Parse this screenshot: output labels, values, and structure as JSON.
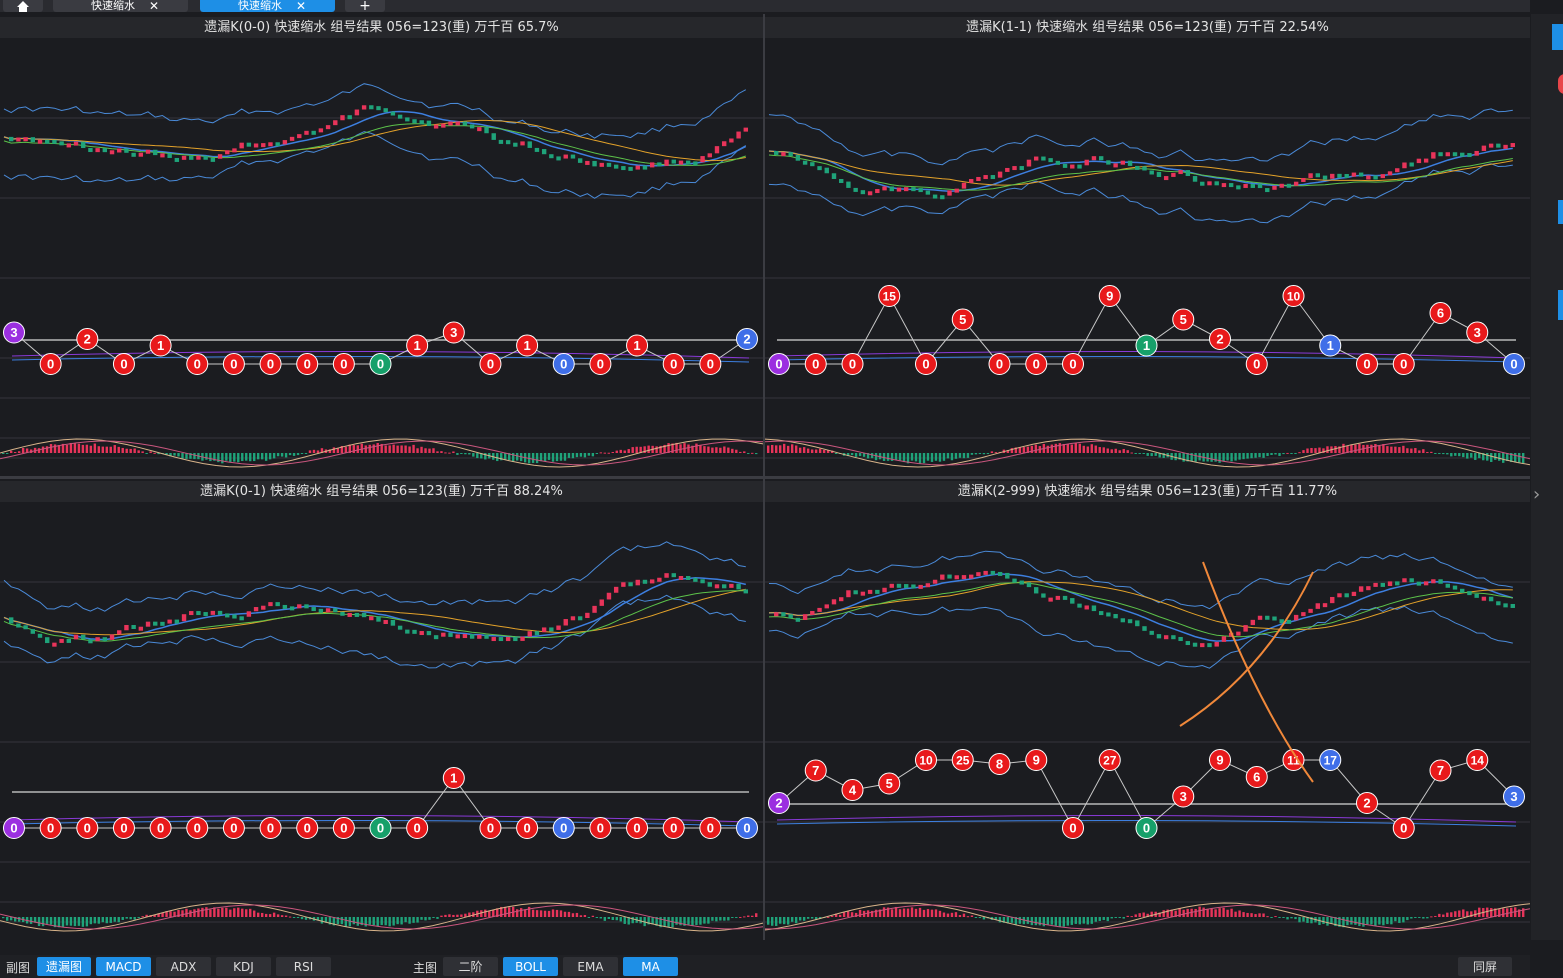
{
  "tabs": [
    {
      "icon": "home-icon"
    },
    {
      "label": "快速缩水",
      "close": "✕"
    },
    {
      "label": "快速缩水",
      "close": "✕",
      "active": true
    },
    {
      "icon": "plus-icon",
      "label": "+"
    }
  ],
  "panels": [
    {
      "title": "遗漏K(0-0)  快速缩水  组号结果 056=123(重)  万千百  65.7%",
      "balls": [
        {
          "v": "3",
          "c": "purple"
        },
        {
          "v": "0",
          "c": "red"
        },
        {
          "v": "2",
          "c": "red"
        },
        {
          "v": "0",
          "c": "red"
        },
        {
          "v": "1",
          "c": "red"
        },
        {
          "v": "0",
          "c": "red"
        },
        {
          "v": "0",
          "c": "red"
        },
        {
          "v": "0",
          "c": "red"
        },
        {
          "v": "0",
          "c": "red"
        },
        {
          "v": "0",
          "c": "red"
        },
        {
          "v": "0",
          "c": "green"
        },
        {
          "v": "1",
          "c": "red"
        },
        {
          "v": "3",
          "c": "red"
        },
        {
          "v": "0",
          "c": "red"
        },
        {
          "v": "1",
          "c": "red"
        },
        {
          "v": "0",
          "c": "blue"
        },
        {
          "v": "0",
          "c": "red"
        },
        {
          "v": "1",
          "c": "red"
        },
        {
          "v": "0",
          "c": "red"
        },
        {
          "v": "0",
          "c": "red"
        },
        {
          "v": "2",
          "c": "blue"
        }
      ]
    },
    {
      "title": "遗漏K(1-1)  快速缩水  组号结果 056=123(重)  万千百  22.54%",
      "balls": [
        {
          "v": "0",
          "c": "purple"
        },
        {
          "v": "0",
          "c": "red"
        },
        {
          "v": "0",
          "c": "red"
        },
        {
          "v": "15",
          "c": "red"
        },
        {
          "v": "0",
          "c": "red"
        },
        {
          "v": "5",
          "c": "red"
        },
        {
          "v": "0",
          "c": "red"
        },
        {
          "v": "0",
          "c": "red"
        },
        {
          "v": "0",
          "c": "red"
        },
        {
          "v": "9",
          "c": "red"
        },
        {
          "v": "1",
          "c": "green"
        },
        {
          "v": "5",
          "c": "red"
        },
        {
          "v": "2",
          "c": "red"
        },
        {
          "v": "0",
          "c": "red"
        },
        {
          "v": "10",
          "c": "red"
        },
        {
          "v": "1",
          "c": "blue"
        },
        {
          "v": "0",
          "c": "red"
        },
        {
          "v": "0",
          "c": "red"
        },
        {
          "v": "6",
          "c": "red"
        },
        {
          "v": "3",
          "c": "red"
        },
        {
          "v": "0",
          "c": "blue"
        }
      ]
    },
    {
      "title": "遗漏K(0-1)  快速缩水  组号结果 056=123(重)  万千百  88.24%",
      "balls": [
        {
          "v": "0",
          "c": "purple"
        },
        {
          "v": "0",
          "c": "red"
        },
        {
          "v": "0",
          "c": "red"
        },
        {
          "v": "0",
          "c": "red"
        },
        {
          "v": "0",
          "c": "red"
        },
        {
          "v": "0",
          "c": "red"
        },
        {
          "v": "0",
          "c": "red"
        },
        {
          "v": "0",
          "c": "red"
        },
        {
          "v": "0",
          "c": "red"
        },
        {
          "v": "0",
          "c": "red"
        },
        {
          "v": "0",
          "c": "green"
        },
        {
          "v": "0",
          "c": "red"
        },
        {
          "v": "1",
          "c": "red"
        },
        {
          "v": "0",
          "c": "red"
        },
        {
          "v": "0",
          "c": "red"
        },
        {
          "v": "0",
          "c": "blue"
        },
        {
          "v": "0",
          "c": "red"
        },
        {
          "v": "0",
          "c": "red"
        },
        {
          "v": "0",
          "c": "red"
        },
        {
          "v": "0",
          "c": "red"
        },
        {
          "v": "0",
          "c": "blue"
        }
      ]
    },
    {
      "title": "遗漏K(2-999)  快速缩水  组号结果 056=123(重)  万千百  11.77%",
      "balls": [
        {
          "v": "2",
          "c": "purple"
        },
        {
          "v": "7",
          "c": "red"
        },
        {
          "v": "4",
          "c": "red"
        },
        {
          "v": "5",
          "c": "red"
        },
        {
          "v": "10",
          "c": "red"
        },
        {
          "v": "25",
          "c": "red"
        },
        {
          "v": "8",
          "c": "red"
        },
        {
          "v": "9",
          "c": "red"
        },
        {
          "v": "0",
          "c": "red"
        },
        {
          "v": "27",
          "c": "red"
        },
        {
          "v": "0",
          "c": "green"
        },
        {
          "v": "3",
          "c": "red"
        },
        {
          "v": "9",
          "c": "red"
        },
        {
          "v": "6",
          "c": "red"
        },
        {
          "v": "11",
          "c": "red"
        },
        {
          "v": "17",
          "c": "blue"
        },
        {
          "v": "2",
          "c": "red"
        },
        {
          "v": "0",
          "c": "red"
        },
        {
          "v": "7",
          "c": "red"
        },
        {
          "v": "14",
          "c": "red"
        },
        {
          "v": "3",
          "c": "blue"
        }
      ]
    }
  ],
  "bottom": {
    "sub_label": "副图",
    "sub_buttons": [
      {
        "label": "遗漏图",
        "active": true
      },
      {
        "label": "MACD",
        "active": true
      },
      {
        "label": "ADX",
        "active": false
      },
      {
        "label": "KDJ",
        "active": false
      },
      {
        "label": "RSI",
        "active": false
      }
    ],
    "main_label": "主图",
    "main_buttons": [
      {
        "label": "二阶",
        "active": false
      },
      {
        "label": "BOLL",
        "active": true
      },
      {
        "label": "EMA",
        "active": false
      },
      {
        "label": "MA",
        "active": true
      }
    ],
    "same_screen": "同屏"
  },
  "colors": {
    "up": "#e8345a",
    "down": "#1fa37a",
    "ball_red": "#e8191b",
    "ball_green": "#16a06a",
    "ball_blue": "#3f6ee8",
    "ball_purple": "#9b2fe0",
    "accent": "#1e8fe6"
  }
}
